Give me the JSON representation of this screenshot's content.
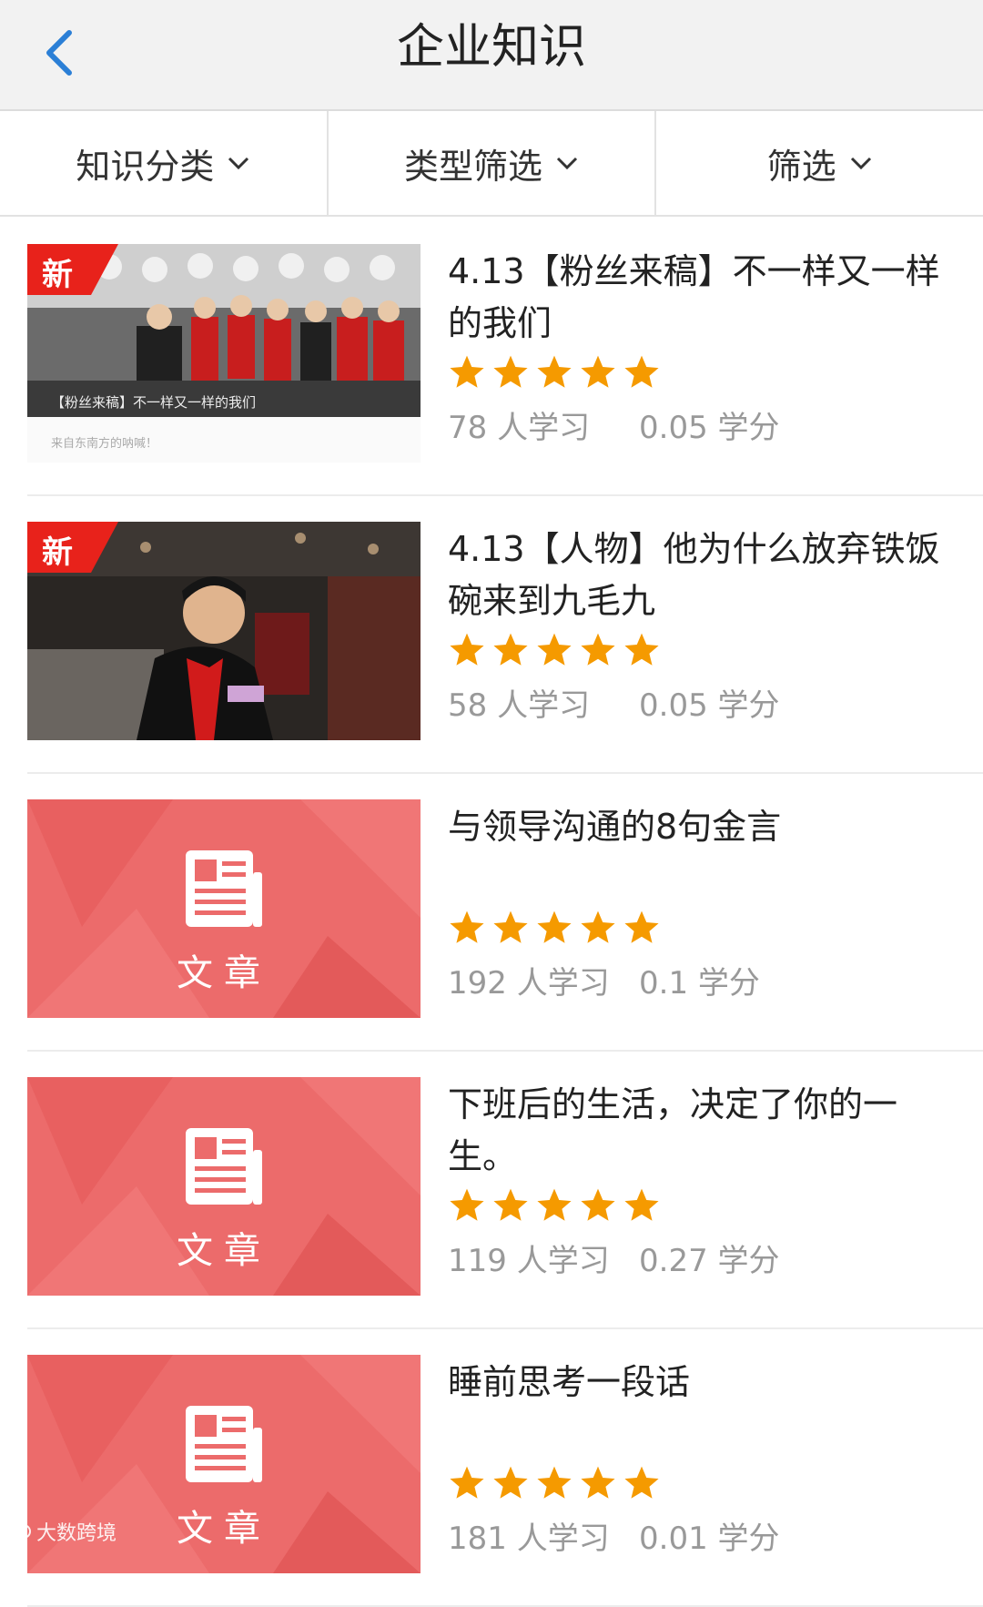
{
  "header": {
    "title": "企业知识",
    "back_icon": "chevron-left-icon"
  },
  "filters": [
    {
      "label": "知识分类"
    },
    {
      "label": "类型筛选"
    },
    {
      "label": "筛选"
    }
  ],
  "colors": {
    "accent_blue": "#2b7fd6",
    "star": "#f59a00",
    "badge_red": "#e8221b",
    "article_bg": "#ec6b6b"
  },
  "items": [
    {
      "title": "4.13【粉丝来稿】不一样又一样的我们",
      "rating": 5,
      "learners": "78 人学习",
      "credits": "0.05 学分",
      "badge": "新",
      "thumb_caption": "【粉丝来稿】不一样又一样的我们",
      "thumb_sub": "来自东南方的呐喊！"
    },
    {
      "title": "4.13【人物】他为什么放弃铁饭碗来到九毛九",
      "rating": 5,
      "learners": "58 人学习",
      "credits": "0.05 学分",
      "badge": "新"
    },
    {
      "title": "与领导沟通的8句金言",
      "rating": 5,
      "learners": "192 人学习",
      "credits": "0.1 学分",
      "thumb_label": "文章"
    },
    {
      "title": "下班后的生活，决定了你的一生。",
      "rating": 5,
      "learners": "119 人学习",
      "credits": "0.27 学分",
      "thumb_label": "文章"
    },
    {
      "title": "睡前思考一段话",
      "rating": 5,
      "learners": "181 人学习",
      "credits": "0.01 学分",
      "thumb_label": "文章"
    }
  ],
  "watermark": "大数跨境"
}
